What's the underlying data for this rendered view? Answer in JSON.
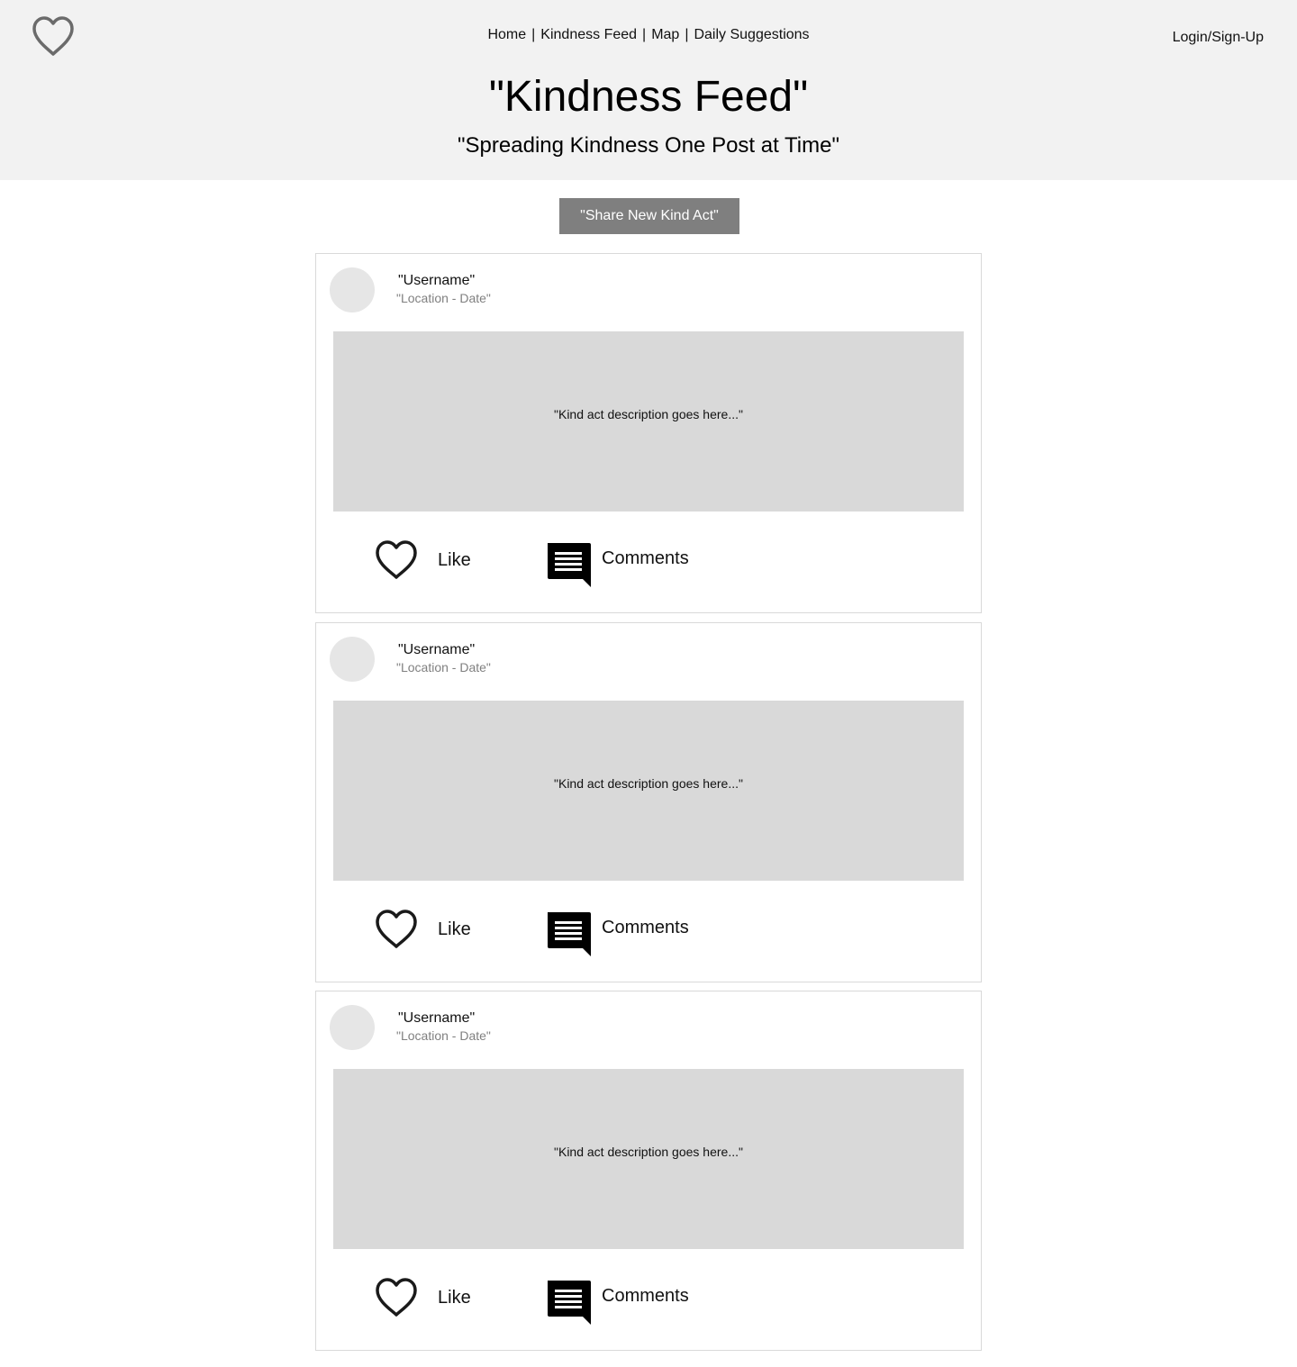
{
  "header": {
    "nav": [
      {
        "label": "Home"
      },
      {
        "label": "Kindness Feed"
      },
      {
        "label": "Map"
      },
      {
        "label": "Daily Suggestions"
      }
    ],
    "login_label": "Login/Sign-Up",
    "title": "\"Kindness Feed\"",
    "subtitle": "\"Spreading Kindness One Post at Time\"",
    "logo_icon": "heart-icon"
  },
  "share_button_label": "\"Share New Kind Act\"",
  "posts": [
    {
      "username": "\"Username\"",
      "meta": "\"Location - Date\"",
      "description": "\"Kind act description goes here...\"",
      "like_label": "Like",
      "comments_label": "Comments"
    },
    {
      "username": "\"Username\"",
      "meta": "\"Location - Date\"",
      "description": "\"Kind act description goes here...\"",
      "like_label": "Like",
      "comments_label": "Comments"
    },
    {
      "username": "\"Username\"",
      "meta": "\"Location - Date\"",
      "description": "\"Kind act description goes here...\"",
      "like_label": "Like",
      "comments_label": "Comments"
    }
  ],
  "colors": {
    "header_bg": "#f2f2f2",
    "button_bg": "#7f7f7f",
    "media_bg": "#d9d9d9",
    "avatar_bg": "#e6e6e6",
    "meta_text": "#808080"
  }
}
